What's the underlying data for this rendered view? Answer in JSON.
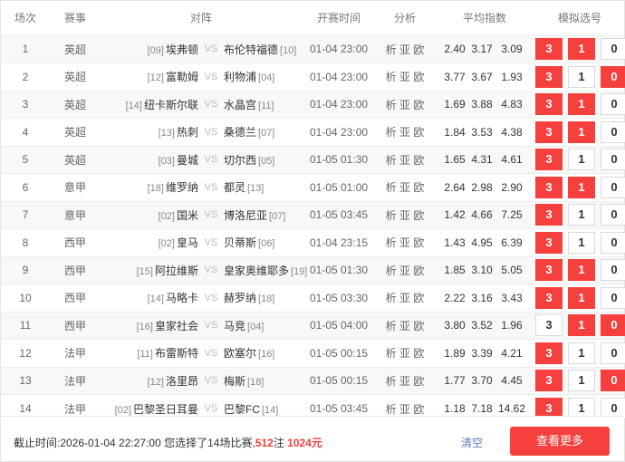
{
  "headers": {
    "index": "场次",
    "league": "赛事",
    "match": "对阵",
    "time": "开赛时间",
    "analysis": "分析",
    "odds": "平均指数",
    "pick": "模拟选号"
  },
  "vs_label": "VS",
  "analysis_links": [
    "析",
    "亚",
    "欧"
  ],
  "rows": [
    {
      "no": "1",
      "league": "英超",
      "home_rank": "[09]",
      "home": "埃弗顿",
      "away": "布伦特福德",
      "away_rank": "[10]",
      "time": "01-04 23:00",
      "odds": [
        "2.40",
        "3.17",
        "3.09"
      ],
      "picks": [
        {
          "label": "3",
          "on": true
        },
        {
          "label": "1",
          "on": true
        },
        {
          "label": "0",
          "on": false
        }
      ]
    },
    {
      "no": "2",
      "league": "英超",
      "home_rank": "[12]",
      "home": "富勒姆",
      "away": "利物浦",
      "away_rank": "[04]",
      "time": "01-04 23:00",
      "odds": [
        "3.77",
        "3.67",
        "1.93"
      ],
      "picks": [
        {
          "label": "3",
          "on": true
        },
        {
          "label": "1",
          "on": false
        },
        {
          "label": "0",
          "on": true
        }
      ]
    },
    {
      "no": "3",
      "league": "英超",
      "home_rank": "[14]",
      "home": "纽卡斯尔联",
      "away": "水晶宫",
      "away_rank": "[11]",
      "time": "01-04 23:00",
      "odds": [
        "1.69",
        "3.88",
        "4.83"
      ],
      "picks": [
        {
          "label": "3",
          "on": true
        },
        {
          "label": "1",
          "on": true
        },
        {
          "label": "0",
          "on": false
        }
      ]
    },
    {
      "no": "4",
      "league": "英超",
      "home_rank": "[13]",
      "home": "热刺",
      "away": "桑德兰",
      "away_rank": "[07]",
      "time": "01-04 23:00",
      "odds": [
        "1.84",
        "3.53",
        "4.38"
      ],
      "picks": [
        {
          "label": "3",
          "on": true
        },
        {
          "label": "1",
          "on": true
        },
        {
          "label": "0",
          "on": false
        }
      ]
    },
    {
      "no": "5",
      "league": "英超",
      "home_rank": "[03]",
      "home": "曼城",
      "away": "切尔西",
      "away_rank": "[05]",
      "time": "01-05 01:30",
      "odds": [
        "1.65",
        "4.31",
        "4.61"
      ],
      "picks": [
        {
          "label": "3",
          "on": true
        },
        {
          "label": "1",
          "on": false
        },
        {
          "label": "0",
          "on": false
        }
      ]
    },
    {
      "no": "6",
      "league": "意甲",
      "home_rank": "[18]",
      "home": "维罗纳",
      "away": "都灵",
      "away_rank": "[13]",
      "time": "01-05 01:00",
      "odds": [
        "2.64",
        "2.98",
        "2.90"
      ],
      "picks": [
        {
          "label": "3",
          "on": true
        },
        {
          "label": "1",
          "on": true
        },
        {
          "label": "0",
          "on": false
        }
      ]
    },
    {
      "no": "7",
      "league": "意甲",
      "home_rank": "[02]",
      "home": "国米",
      "away": "博洛尼亚",
      "away_rank": "[07]",
      "time": "01-05 03:45",
      "odds": [
        "1.42",
        "4.66",
        "7.25"
      ],
      "picks": [
        {
          "label": "3",
          "on": true
        },
        {
          "label": "1",
          "on": false
        },
        {
          "label": "0",
          "on": false
        }
      ]
    },
    {
      "no": "8",
      "league": "西甲",
      "home_rank": "[02]",
      "home": "皇马",
      "away": "贝蒂斯",
      "away_rank": "[06]",
      "time": "01-04 23:15",
      "odds": [
        "1.43",
        "4.95",
        "6.39"
      ],
      "picks": [
        {
          "label": "3",
          "on": true
        },
        {
          "label": "1",
          "on": false
        },
        {
          "label": "0",
          "on": false
        }
      ]
    },
    {
      "no": "9",
      "league": "西甲",
      "home_rank": "[15]",
      "home": "阿拉维斯",
      "away": "皇家奥维耶多",
      "away_rank": "[19]",
      "time": "01-05 01:30",
      "odds": [
        "1.85",
        "3.10",
        "5.05"
      ],
      "picks": [
        {
          "label": "3",
          "on": true
        },
        {
          "label": "1",
          "on": true
        },
        {
          "label": "0",
          "on": false
        }
      ]
    },
    {
      "no": "10",
      "league": "西甲",
      "home_rank": "[14]",
      "home": "马略卡",
      "away": "赫罗纳",
      "away_rank": "[18]",
      "time": "01-05 03:30",
      "odds": [
        "2.22",
        "3.16",
        "3.43"
      ],
      "picks": [
        {
          "label": "3",
          "on": true
        },
        {
          "label": "1",
          "on": true
        },
        {
          "label": "0",
          "on": false
        }
      ]
    },
    {
      "no": "11",
      "league": "西甲",
      "home_rank": "[16]",
      "home": "皇家社会",
      "away": "马竞",
      "away_rank": "[04]",
      "time": "01-05 04:00",
      "odds": [
        "3.80",
        "3.52",
        "1.96"
      ],
      "picks": [
        {
          "label": "3",
          "on": false
        },
        {
          "label": "1",
          "on": true
        },
        {
          "label": "0",
          "on": true
        }
      ]
    },
    {
      "no": "12",
      "league": "法甲",
      "home_rank": "[11]",
      "home": "布雷斯特",
      "away": "欧塞尔",
      "away_rank": "[16]",
      "time": "01-05 00:15",
      "odds": [
        "1.89",
        "3.39",
        "4.21"
      ],
      "picks": [
        {
          "label": "3",
          "on": true
        },
        {
          "label": "1",
          "on": false
        },
        {
          "label": "0",
          "on": false
        }
      ]
    },
    {
      "no": "13",
      "league": "法甲",
      "home_rank": "[12]",
      "home": "洛里昂",
      "away": "梅斯",
      "away_rank": "[18]",
      "time": "01-05 00:15",
      "odds": [
        "1.77",
        "3.70",
        "4.45"
      ],
      "picks": [
        {
          "label": "3",
          "on": true
        },
        {
          "label": "1",
          "on": false
        },
        {
          "label": "0",
          "on": true
        }
      ]
    },
    {
      "no": "14",
      "league": "法甲",
      "home_rank": "[02]",
      "home": "巴黎圣日耳曼",
      "away": "巴黎FC",
      "away_rank": "[14]",
      "time": "01-05 03:45",
      "odds": [
        "1.18",
        "7.18",
        "14.62"
      ],
      "picks": [
        {
          "label": "3",
          "on": true
        },
        {
          "label": "1",
          "on": false
        },
        {
          "label": "0",
          "on": false
        }
      ]
    }
  ],
  "footer": {
    "deadline_prefix": "截止时间:2026-01-04 22:27:00 您选择了14场比赛,",
    "bets": "512",
    "bets_unit": "注",
    "amount": "1024元",
    "clear_label": "清空",
    "more_label": "查看更多"
  },
  "colors": {
    "accent": "#f5403d",
    "link": "#5a7fb5"
  }
}
